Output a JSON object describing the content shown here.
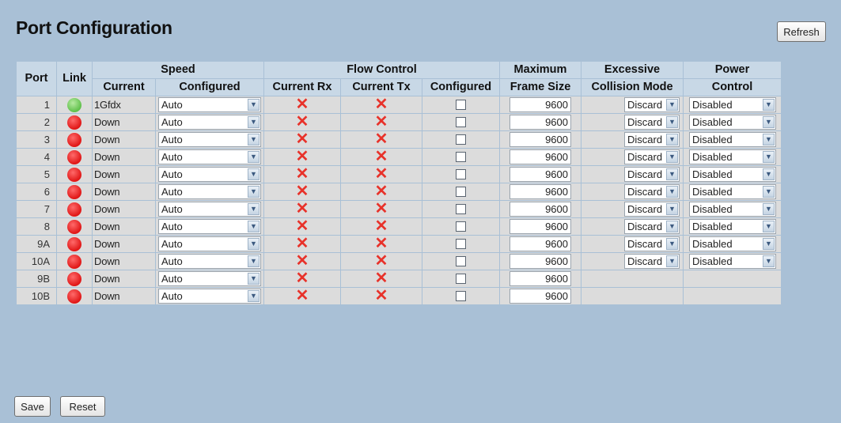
{
  "page": {
    "title": "Port Configuration",
    "refresh_label": "Refresh",
    "save_label": "Save",
    "reset_label": "Reset"
  },
  "headers": {
    "port": "Port",
    "link": "Link",
    "speed": "Speed",
    "speed_current": "Current",
    "speed_configured": "Configured",
    "flow_control": "Flow Control",
    "fc_current_rx": "Current Rx",
    "fc_current_tx": "Current Tx",
    "fc_configured": "Configured",
    "max_frame_line1": "Maximum",
    "max_frame_line2": "Frame Size",
    "excessive_line1": "Excessive",
    "excessive_line2": "Collision Mode",
    "power_line1": "Power",
    "power_line2": "Control"
  },
  "status_colors": {
    "link_up": "#5fc04a",
    "link_down": "#e01616",
    "flow_off": "#e8322a"
  },
  "rows": [
    {
      "port": "1",
      "link": "up",
      "current": "1Gfdx",
      "configured": "Auto",
      "rx": "x",
      "tx": "x",
      "fc_checked": false,
      "frame_size": "9600",
      "collision": "Discard",
      "power": "Disabled"
    },
    {
      "port": "2",
      "link": "down",
      "current": "Down",
      "configured": "Auto",
      "rx": "x",
      "tx": "x",
      "fc_checked": false,
      "frame_size": "9600",
      "collision": "Discard",
      "power": "Disabled"
    },
    {
      "port": "3",
      "link": "down",
      "current": "Down",
      "configured": "Auto",
      "rx": "x",
      "tx": "x",
      "fc_checked": false,
      "frame_size": "9600",
      "collision": "Discard",
      "power": "Disabled"
    },
    {
      "port": "4",
      "link": "down",
      "current": "Down",
      "configured": "Auto",
      "rx": "x",
      "tx": "x",
      "fc_checked": false,
      "frame_size": "9600",
      "collision": "Discard",
      "power": "Disabled"
    },
    {
      "port": "5",
      "link": "down",
      "current": "Down",
      "configured": "Auto",
      "rx": "x",
      "tx": "x",
      "fc_checked": false,
      "frame_size": "9600",
      "collision": "Discard",
      "power": "Disabled"
    },
    {
      "port": "6",
      "link": "down",
      "current": "Down",
      "configured": "Auto",
      "rx": "x",
      "tx": "x",
      "fc_checked": false,
      "frame_size": "9600",
      "collision": "Discard",
      "power": "Disabled"
    },
    {
      "port": "7",
      "link": "down",
      "current": "Down",
      "configured": "Auto",
      "rx": "x",
      "tx": "x",
      "fc_checked": false,
      "frame_size": "9600",
      "collision": "Discard",
      "power": "Disabled"
    },
    {
      "port": "8",
      "link": "down",
      "current": "Down",
      "configured": "Auto",
      "rx": "x",
      "tx": "x",
      "fc_checked": false,
      "frame_size": "9600",
      "collision": "Discard",
      "power": "Disabled"
    },
    {
      "port": "9A",
      "link": "down",
      "current": "Down",
      "configured": "Auto",
      "rx": "x",
      "tx": "x",
      "fc_checked": false,
      "frame_size": "9600",
      "collision": "Discard",
      "power": "Disabled"
    },
    {
      "port": "10A",
      "link": "down",
      "current": "Down",
      "configured": "Auto",
      "rx": "x",
      "tx": "x",
      "fc_checked": false,
      "frame_size": "9600",
      "collision": "Discard",
      "power": "Disabled"
    },
    {
      "port": "9B",
      "link": "down",
      "current": "Down",
      "configured": "Auto",
      "rx": "x",
      "tx": "x",
      "fc_checked": false,
      "frame_size": "9600",
      "collision": "",
      "power": ""
    },
    {
      "port": "10B",
      "link": "down",
      "current": "Down",
      "configured": "Auto",
      "rx": "x",
      "tx": "x",
      "fc_checked": false,
      "frame_size": "9600",
      "collision": "",
      "power": ""
    }
  ]
}
